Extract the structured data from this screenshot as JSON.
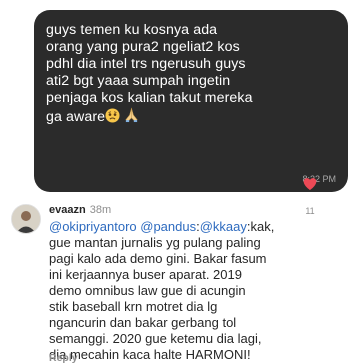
{
  "dm": {
    "message_line1": "guys temen ku kosnya ada",
    "message_line2": "orang yang pura2 ngeliat2 kos",
    "message_line3": "pdhl dia intel trs ngerusuh guys",
    "message_line4": "ati2 bgt yaaa sumpah ingetin",
    "message_line5": "penjaga kos kalian takut mereka",
    "message_line6": "ga aware",
    "time": "8:22 PM",
    "emoji": [
      "worried-face",
      "folded-hands"
    ],
    "bubble_color": "#2b2b2b"
  },
  "comment": {
    "username": "evaazn",
    "time": "38m",
    "mention1": "@okipriyantoro",
    "mention2": "@pandus",
    "mention3": "@kkaay",
    "line1_rest": ":kak,",
    "body": "gue mantan jurnalis yg pulang paling\npagi kalo ada demo gini. Bakar fasum\nini kerjaannya buser aparat. 2019\ndemo omnibus law gue di acungin\nstik baseball krn motret dia lg\nngancurin dan bakar gerbang tol\nsemanggi. 2020 gue ketemu dia lagi,\ndia mecahin kaca halte HARMONI!",
    "reply_label": "Reply",
    "like_count": "11",
    "mention_color": "#2e6bbf",
    "heart_color": "#ed4956"
  }
}
